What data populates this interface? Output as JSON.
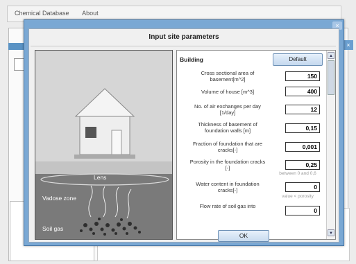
{
  "app": {
    "menu": [
      "Chemical Database",
      "About"
    ],
    "close_glyph": "×"
  },
  "dialog": {
    "title": "Input site parameters",
    "close_glyph": "×",
    "ok_label": "OK"
  },
  "illustration": {
    "labels": {
      "lens": "Lens",
      "vadose": "Vadose zone",
      "soilgas": "Soil gas"
    }
  },
  "params": {
    "section": "Building",
    "default_label": "Default",
    "rows": [
      {
        "label": "Cross sectional area of basement[m^2]",
        "value": "150",
        "hint": ""
      },
      {
        "label": "Volume of house [m^3]",
        "value": "400",
        "hint": ""
      },
      {
        "label": "No. of air exchanges per day [1/day]",
        "value": "12",
        "hint": ""
      },
      {
        "label": "Thickness of basement of foundation walls [m]",
        "value": "0,15",
        "hint": ""
      },
      {
        "label": "Fraction of foundation that are cracks[-]",
        "value": "0,001",
        "hint": ""
      },
      {
        "label": "Porosity in the foundation cracks [-]",
        "value": "0,25",
        "hint": "between 0 and 0,6"
      },
      {
        "label": "Water content in foundation cracks[-]",
        "value": "0",
        "hint": "value < porosity"
      },
      {
        "label": "Flow rate of soil gas into",
        "value": "0",
        "hint": ""
      }
    ]
  },
  "scroll": {
    "up": "▲",
    "down": "▼"
  }
}
